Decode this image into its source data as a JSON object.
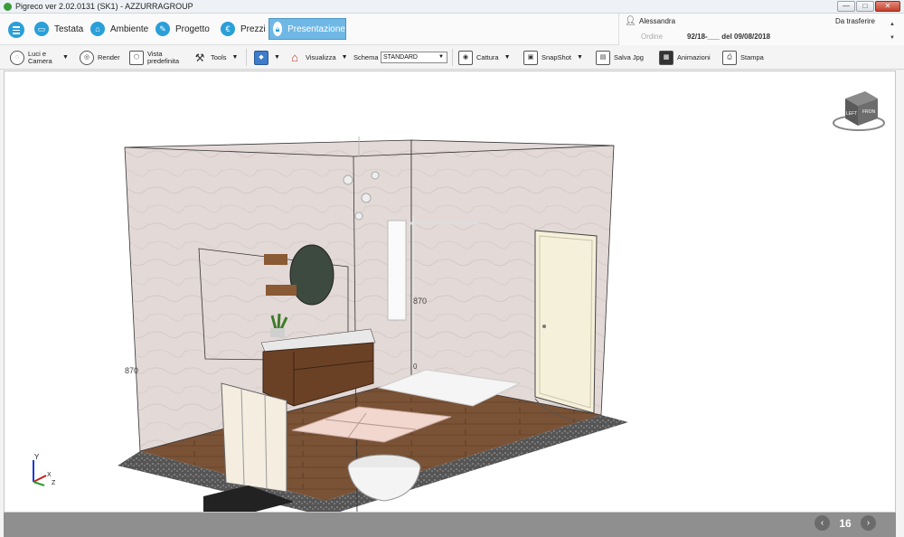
{
  "window": {
    "title": "Pigreco ver 2.02.0131 (SK1) - AZZURRAGROUP"
  },
  "nav": {
    "items": [
      {
        "label": "Testata",
        "icon": "screen-icon"
      },
      {
        "label": "Ambiente",
        "icon": "home-icon"
      },
      {
        "label": "Progetto",
        "icon": "pencil-icon"
      },
      {
        "label": "Prezzi",
        "icon": "euro-icon"
      },
      {
        "label": "Presentazione",
        "icon": "lock-icon"
      }
    ],
    "active": "Presentazione"
  },
  "user": {
    "name": "Alessandra",
    "order_label": "Ordine",
    "order_value": "92/18-___ del 09/08/2018",
    "transfer_label": "Da trasferire"
  },
  "toolbar": {
    "lights_camera": "Luci e Camera",
    "render": "Render",
    "default_view": "Vista predefinita",
    "tools": "Tools",
    "visualize": "Visualizza",
    "schema_label": "Schema",
    "schema_value": "STANDARD",
    "capture": "Cattura",
    "snapshot": "SnapShot",
    "save_jpg": "Salva Jpg",
    "animations": "Animazioni",
    "print": "Stampa"
  },
  "scene": {
    "dim_left": "870",
    "dim_center": "870",
    "dim_zero": "0",
    "cube_left": "LEFT",
    "cube_front": "FRON",
    "axes": {
      "x": "X",
      "y": "Y",
      "z": "Z"
    },
    "colors": {
      "wall": "#e2d8d6",
      "floor": "#6e4a32",
      "door": "#f5f0da",
      "rug": "#f2d7cf"
    }
  },
  "pager": {
    "page": "16"
  }
}
